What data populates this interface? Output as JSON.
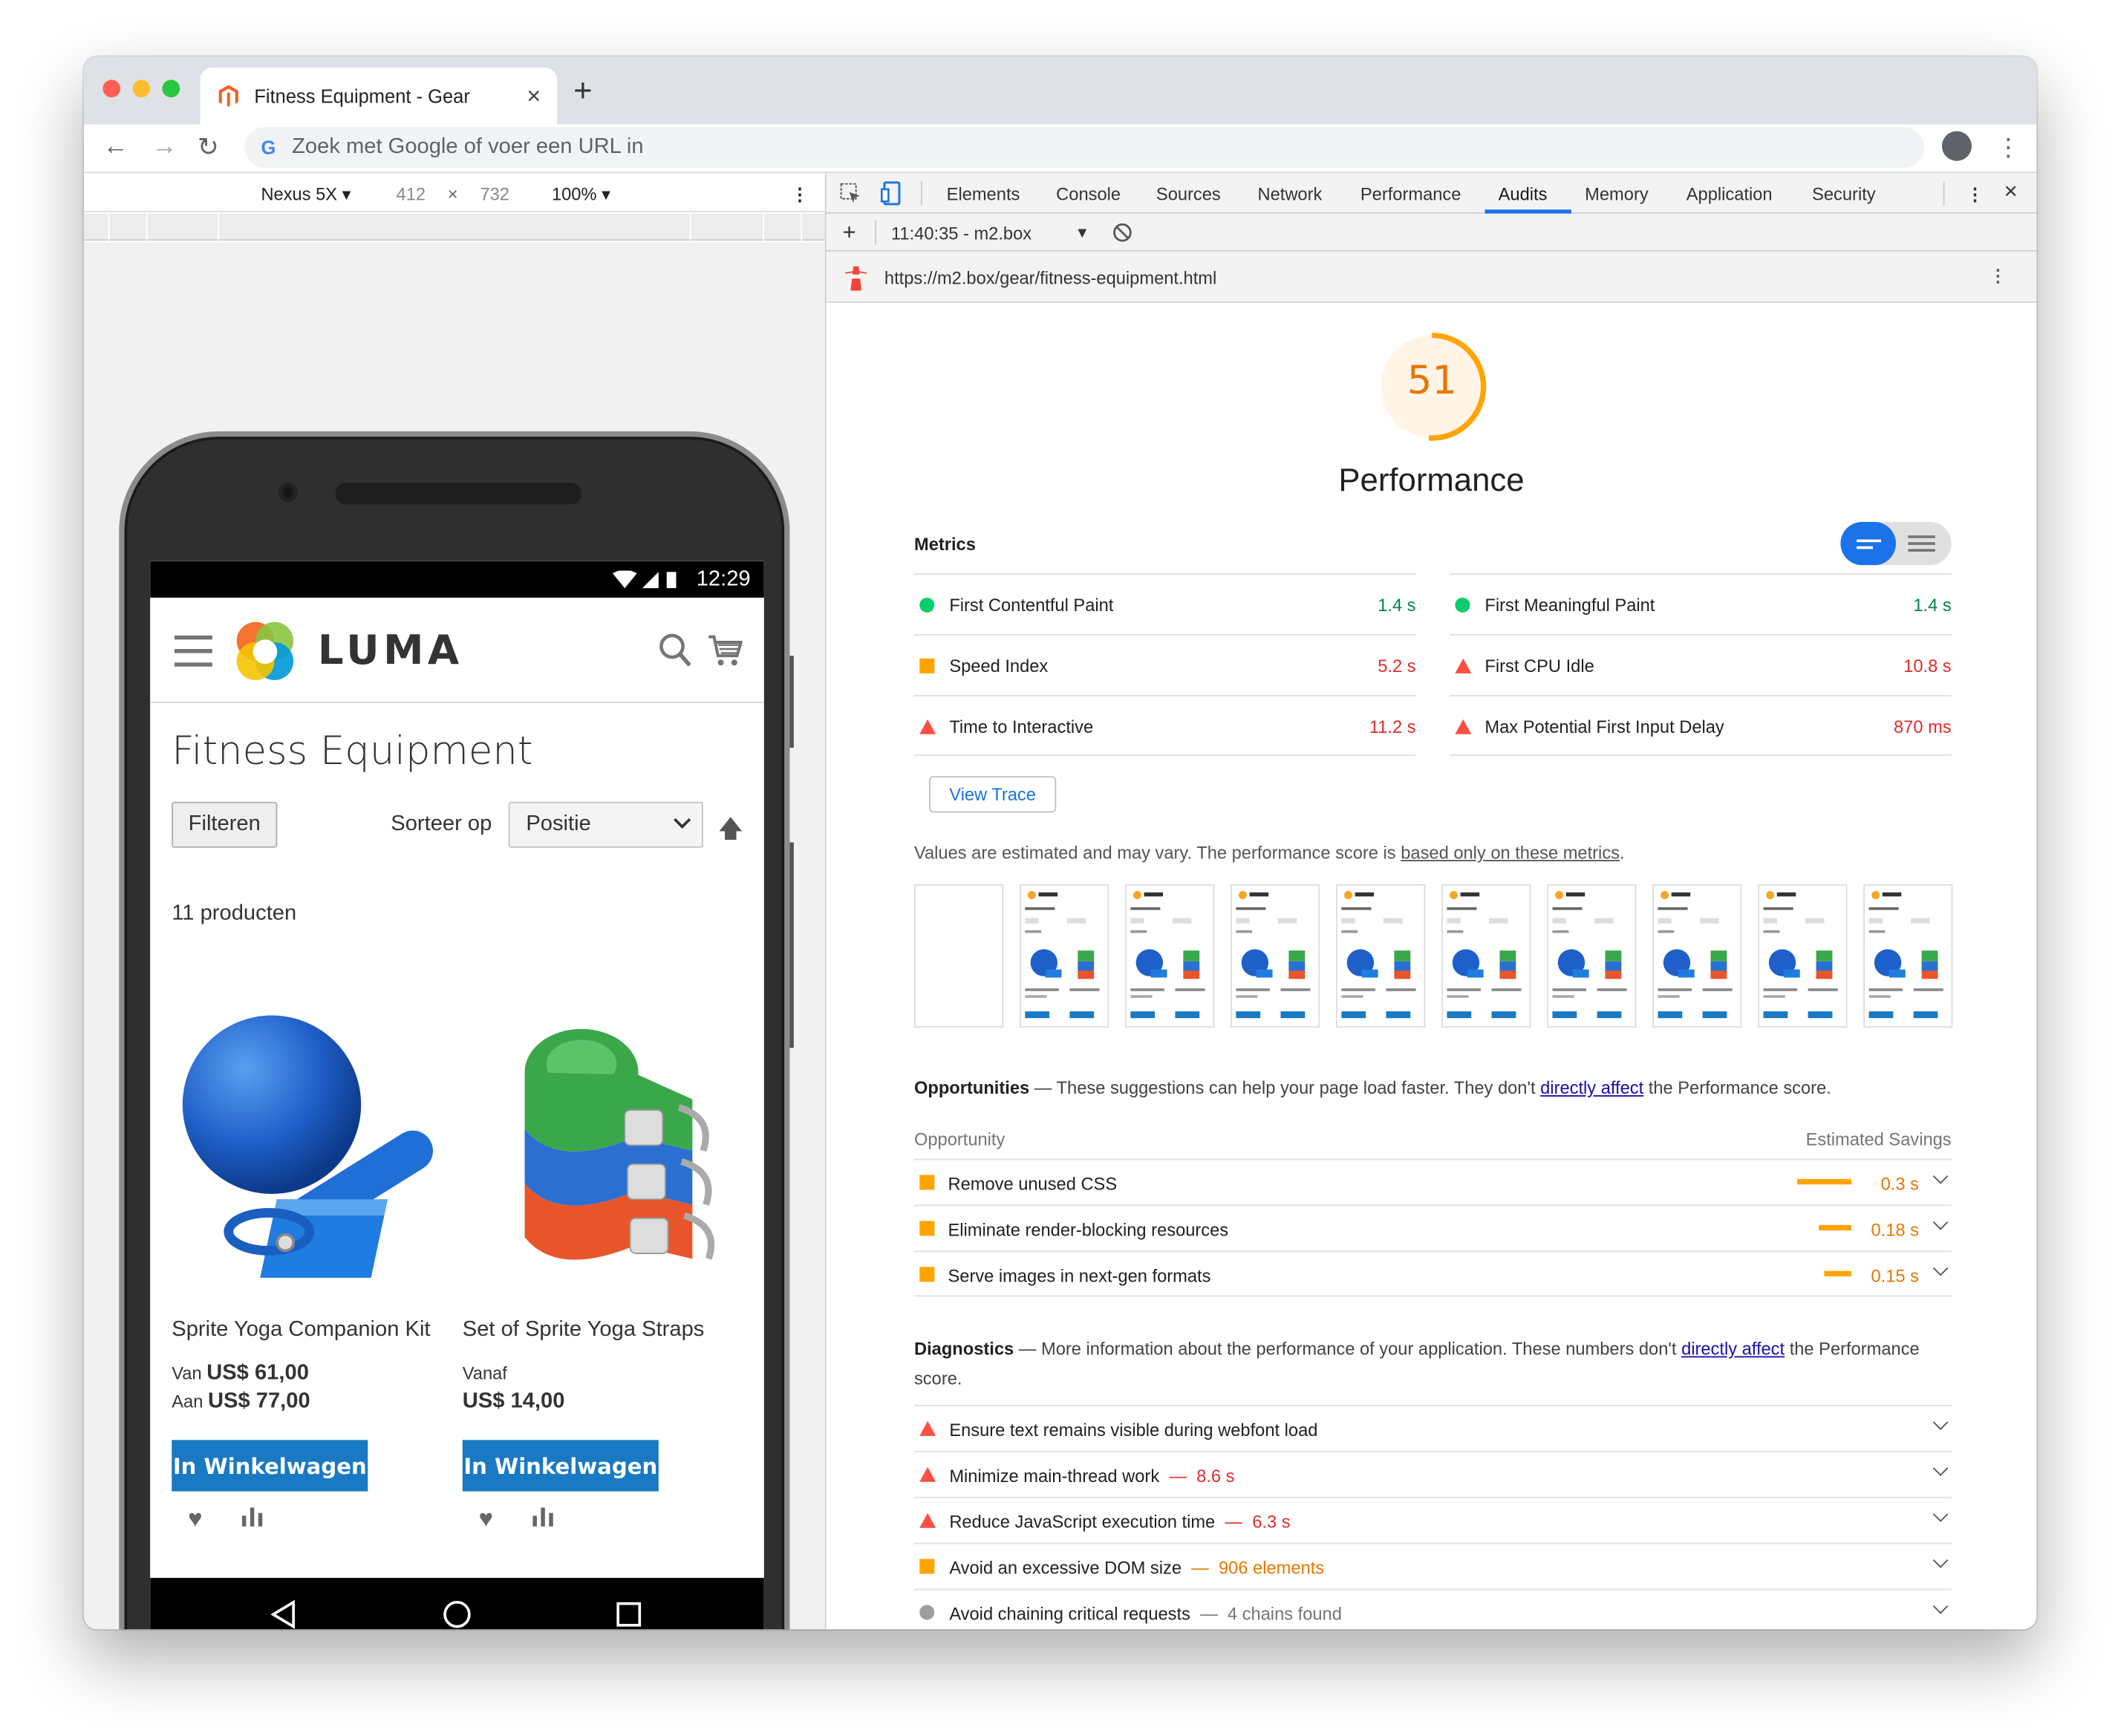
{
  "browser": {
    "tab_title": "Fitness Equipment - Gear",
    "tab_close": "×",
    "new_tab": "+",
    "omnibox_placeholder": "Zoek met Google of voer een URL in",
    "traffic_colors": [
      "#ff5f57",
      "#febc2e",
      "#28c840"
    ]
  },
  "device_toolbar": {
    "device": "Nexus 5X ▾",
    "width": "412",
    "times": "×",
    "height": "732",
    "zoom": "100% ▾",
    "more": "⋮"
  },
  "phone": {
    "time": "12:29",
    "brand": "LUMA",
    "page_title": "Fitness Equipment",
    "filter_label": "Filteren",
    "sort_label": "Sorteer op",
    "sort_value": "Positie",
    "sort_arrow": "🡅",
    "product_count": "11 producten",
    "products": [
      {
        "name": "Sprite Yoga Companion Kit",
        "price_line1_prefix": "Van ",
        "price_line1": "US$ 61,00",
        "price_line2_prefix": "Aan ",
        "price_line2": "US$ 77,00",
        "button": "In Winkelwagen"
      },
      {
        "name": "Set of Sprite Yoga Straps",
        "price_line1_prefix": "Vanaf",
        "price_line1": "",
        "price_line2_prefix": "",
        "price_line2": "US$ 14,00",
        "button": "In Winkelwagen"
      }
    ],
    "heart": "♥"
  },
  "devtools": {
    "tabs": [
      "Elements",
      "Console",
      "Sources",
      "Network",
      "Performance",
      "Audits",
      "Memory",
      "Application",
      "Security"
    ],
    "active_tab": "Audits",
    "close": "×",
    "more": "⋮",
    "session": "11:40:35 - m2.box",
    "add": "+",
    "dropdown": "▾",
    "audit_url": "https://m2.box/gear/fitness-equipment.html"
  },
  "report": {
    "score": "51",
    "score_fraction": 0.51,
    "category": "Performance",
    "metrics_heading": "Metrics",
    "metrics": [
      {
        "name": "First Contentful Paint",
        "value": "1.4 s",
        "status": "pass"
      },
      {
        "name": "First Meaningful Paint",
        "value": "1.4 s",
        "status": "pass"
      },
      {
        "name": "Speed Index",
        "value": "5.2 s",
        "status": "average"
      },
      {
        "name": "First CPU Idle",
        "value": "10.8 s",
        "status": "fail"
      },
      {
        "name": "Time to Interactive",
        "value": "11.2 s",
        "status": "fail"
      },
      {
        "name": "Max Potential First Input Delay",
        "value": "870 ms",
        "status": "fail"
      }
    ],
    "view_trace": "View Trace",
    "note_prefix": "Values are estimated and may vary. The performance score is ",
    "note_link": "based only on these metrics",
    "note_suffix": ".",
    "opportunities_title": "Opportunities",
    "opportunities_dash": " — ",
    "opportunities_desc": "These suggestions can help your page load faster. They don't ",
    "opportunities_link": "directly affect",
    "opportunities_tail": " the Performance score.",
    "col_opportunity": "Opportunity",
    "col_savings": "Estimated Savings",
    "opportunities": [
      {
        "name": "Remove unused CSS",
        "savings": "0.3 s",
        "seconds": 0.3
      },
      {
        "name": "Eliminate render-blocking resources",
        "savings": "0.18 s",
        "seconds": 0.18
      },
      {
        "name": "Serve images in next-gen formats",
        "savings": "0.15 s",
        "seconds": 0.15
      }
    ],
    "diagnostics_title": "Diagnostics",
    "diagnostics_dash": " — ",
    "diagnostics_desc": "More information about the performance of your application. These numbers don't ",
    "diagnostics_link": "directly affect",
    "diagnostics_tail": " the Performance score.",
    "diagnostics": [
      {
        "name": "Ensure text remains visible during webfont load",
        "detail": "",
        "status": "fail"
      },
      {
        "name": "Minimize main-thread work",
        "detail": "8.6 s",
        "status": "fail"
      },
      {
        "name": "Reduce JavaScript execution time",
        "detail": "6.3 s",
        "status": "fail"
      },
      {
        "name": "Avoid an excessive DOM size",
        "detail": "906 elements",
        "status": "average"
      },
      {
        "name": "Avoid chaining critical requests",
        "detail": "4 chains found",
        "status": "info"
      }
    ],
    "colors": {
      "pass": "#0cce6b",
      "average": "#ffa400",
      "fail": "#ff4e42",
      "accent": "#1a73e8"
    }
  }
}
